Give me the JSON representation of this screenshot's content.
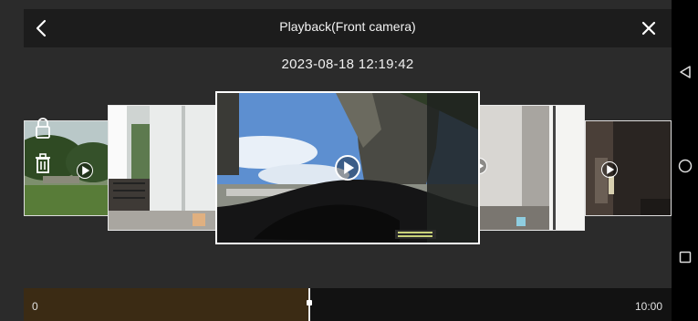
{
  "header": {
    "title": "Playback(Front camera)",
    "back_icon": "chevron-left-icon",
    "close_icon": "close-icon"
  },
  "timestamp": "2023-08-18 12:19:42",
  "thumbnails": [
    {
      "scene": "garden-bushes",
      "selected": false
    },
    {
      "scene": "house-veranda",
      "selected": false
    },
    {
      "scene": "car-interior-tree",
      "selected": true
    },
    {
      "scene": "wall-corner",
      "selected": false
    },
    {
      "scene": "dark-room",
      "selected": false
    }
  ],
  "side_tools": [
    "lock-icon",
    "trash-icon"
  ],
  "timeline": {
    "start_label": "0",
    "end_label": "10:00",
    "progress": 0.44,
    "fill_color": "#3b2b14"
  },
  "system_nav": [
    "back-triangle-icon",
    "home-circle-icon",
    "recents-square-icon"
  ],
  "colors": {
    "background": "#2b2b2b",
    "header": "#1c1c1c",
    "selected_border": "#ffffff"
  }
}
